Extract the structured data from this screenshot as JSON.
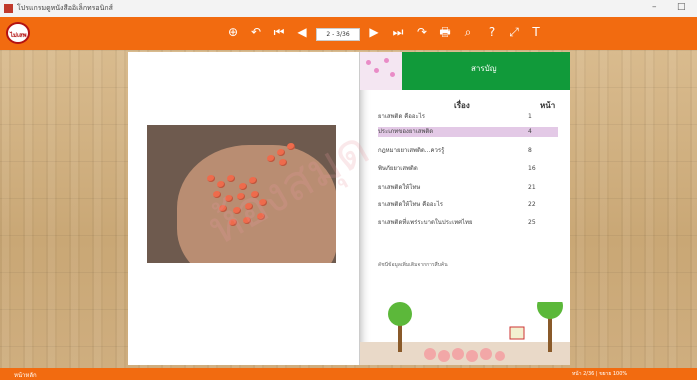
{
  "window": {
    "title": "โปรแกรมดูหนังสืออิเล็กทรอนิกส์",
    "minimize": "–",
    "restore": "□"
  },
  "toolbar": {
    "logo_text": "ไม่เสพ",
    "page_value": "2 - 3/36",
    "buttons": [
      {
        "name": "zoom-in-icon",
        "glyph": "⊕"
      },
      {
        "name": "undo-icon",
        "glyph": "↶"
      },
      {
        "name": "first-page-icon",
        "glyph": "⏮"
      },
      {
        "name": "prev-page-icon",
        "glyph": "◀"
      },
      {
        "name": "next-page-icon",
        "glyph": "▶"
      },
      {
        "name": "last-page-icon",
        "glyph": "⏭"
      },
      {
        "name": "redo-icon",
        "glyph": "↷"
      },
      {
        "name": "print-icon",
        "glyph": "🖶"
      },
      {
        "name": "search-icon",
        "glyph": "⌕"
      },
      {
        "name": "help-icon",
        "glyph": "?"
      },
      {
        "name": "fullscreen-icon",
        "glyph": "⤢"
      },
      {
        "name": "text-icon",
        "glyph": "T"
      }
    ]
  },
  "toc": {
    "banner": "สารบัญ",
    "header_topic": "เรื่อง",
    "header_page": "หน้า",
    "items": [
      {
        "label": "ยาเสพติด คืออะไร",
        "page": "1"
      },
      {
        "label": "ประเภทของยาเสพติด",
        "page": "4",
        "highlight": true
      },
      {
        "label": "กฎหมายยาเสพติด...ควรรู้",
        "page": "8"
      },
      {
        "label": "พิษภัยยาเสพติด",
        "page": "16"
      },
      {
        "label": "ยาเสพติดให้โทษ",
        "page": "21"
      },
      {
        "label": "ยาเสพติดให้โทษ คืออะไร",
        "page": "22"
      },
      {
        "label": "ยาเสพติดที่แพร่ระบาดในประเทศไทย",
        "page": "25"
      }
    ],
    "note": "ดัชนีข้อมูลเพิ่มเติมจากการสืบค้น"
  },
  "status": {
    "left": "หน้าหลัก",
    "right": "หน้า 2/36 | ขยาย 100%"
  },
  "colors": {
    "toolbar": "#f26b10",
    "banner_green": "#119a3a",
    "highlight": "#e3c9e6"
  }
}
